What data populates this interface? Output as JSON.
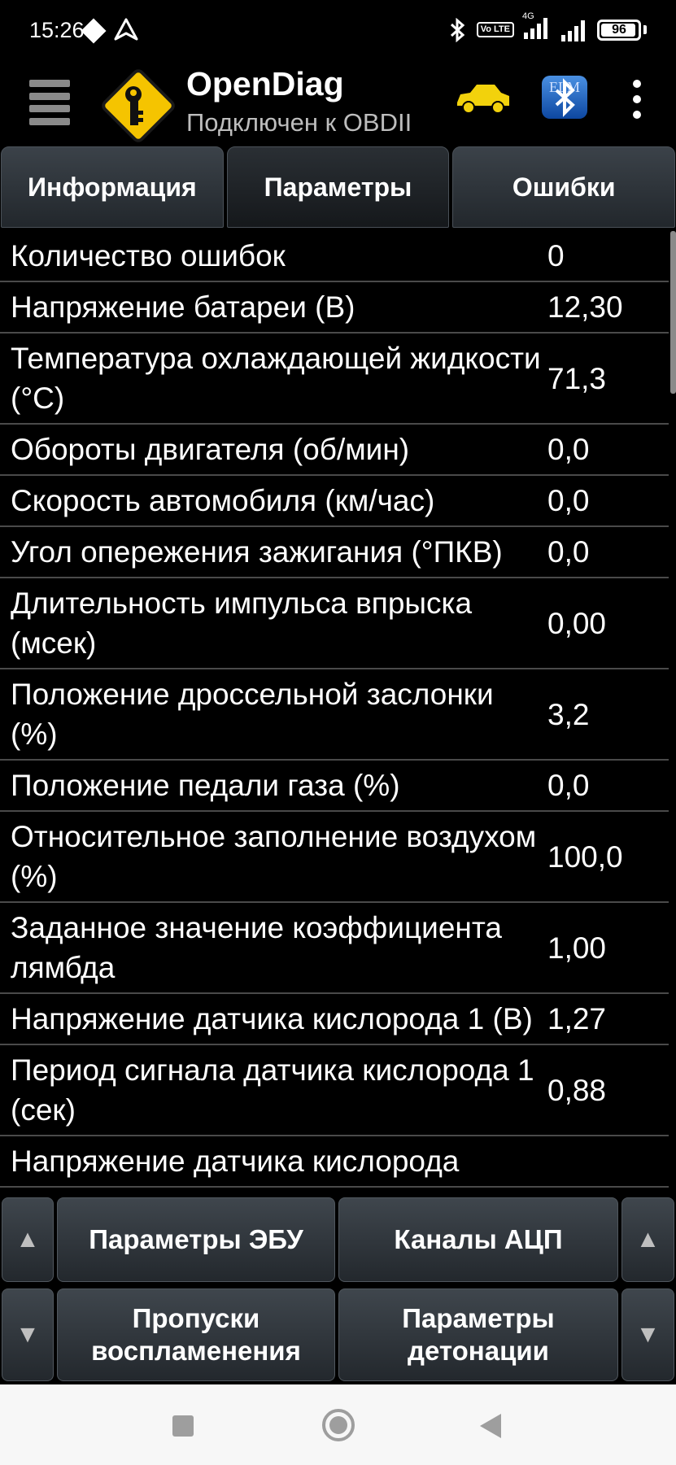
{
  "status_bar": {
    "time": "15:26",
    "volte_label": "Vo LTE",
    "network": "4G",
    "battery_level": "96",
    "battery_percent": 96,
    "icons": [
      "diamond-icon",
      "location-arrow-icon",
      "bluetooth-icon",
      "volte-icon",
      "signal-icon",
      "signal-icon",
      "battery-icon"
    ]
  },
  "app_bar": {
    "title": "OpenDiag",
    "subtitle": "Подключен к OBDII",
    "icons": [
      "menu-icon",
      "key-logo-icon",
      "car-icon",
      "bluetooth-elm-icon",
      "overflow-menu-icon"
    ],
    "bt_badge": "ELM",
    "colors": {
      "logo_yellow": "#f5c400",
      "car_yellow": "#f2d20c",
      "bt_blue": "#1565c0"
    }
  },
  "tabs": [
    {
      "label": "Информация",
      "active": false
    },
    {
      "label": "Параметры",
      "active": true
    },
    {
      "label": "Ошибки",
      "active": false
    }
  ],
  "parameters": [
    {
      "name": "Количество ошибок",
      "value": "0"
    },
    {
      "name": "Напряжение батареи (В)",
      "value": "12,30"
    },
    {
      "name": "Температура охлаждающей жидкости (°С)",
      "value": "71,3"
    },
    {
      "name": "Обороты двигателя (об/мин)",
      "value": "0,0"
    },
    {
      "name": "Скорость автомобиля (км/час)",
      "value": "0,0"
    },
    {
      "name": "Угол опережения зажигания (°ПКВ)",
      "value": "0,0"
    },
    {
      "name": "Длительность импульса впрыска (мсек)",
      "value": "0,00"
    },
    {
      "name": "Положение дроссельной заслонки (%)",
      "value": "3,2"
    },
    {
      "name": "Положение педали газа (%)",
      "value": "0,0"
    },
    {
      "name": "Относительное заполнение воздухом (%)",
      "value": "100,0"
    },
    {
      "name": "Заданное значение коэффициента лямбда",
      "value": "1,00"
    },
    {
      "name": "Напряжение датчика кислорода 1 (В)",
      "value": "1,27"
    },
    {
      "name": "Период сигнала датчика кислорода 1 (сек)",
      "value": "0,88"
    },
    {
      "name": "Напряжение датчика кислорода",
      "value": ""
    }
  ],
  "bottom_panel": {
    "up_arrow": "▲",
    "down_arrow": "▼",
    "ecu_params": "Параметры ЭБУ",
    "adc_channels": "Каналы АЦП",
    "misfires": "Пропуски воспламенения",
    "knock_params": "Параметры детонации"
  },
  "nav_bar": {
    "icons": [
      "recents-icon",
      "home-icon",
      "back-icon"
    ]
  }
}
